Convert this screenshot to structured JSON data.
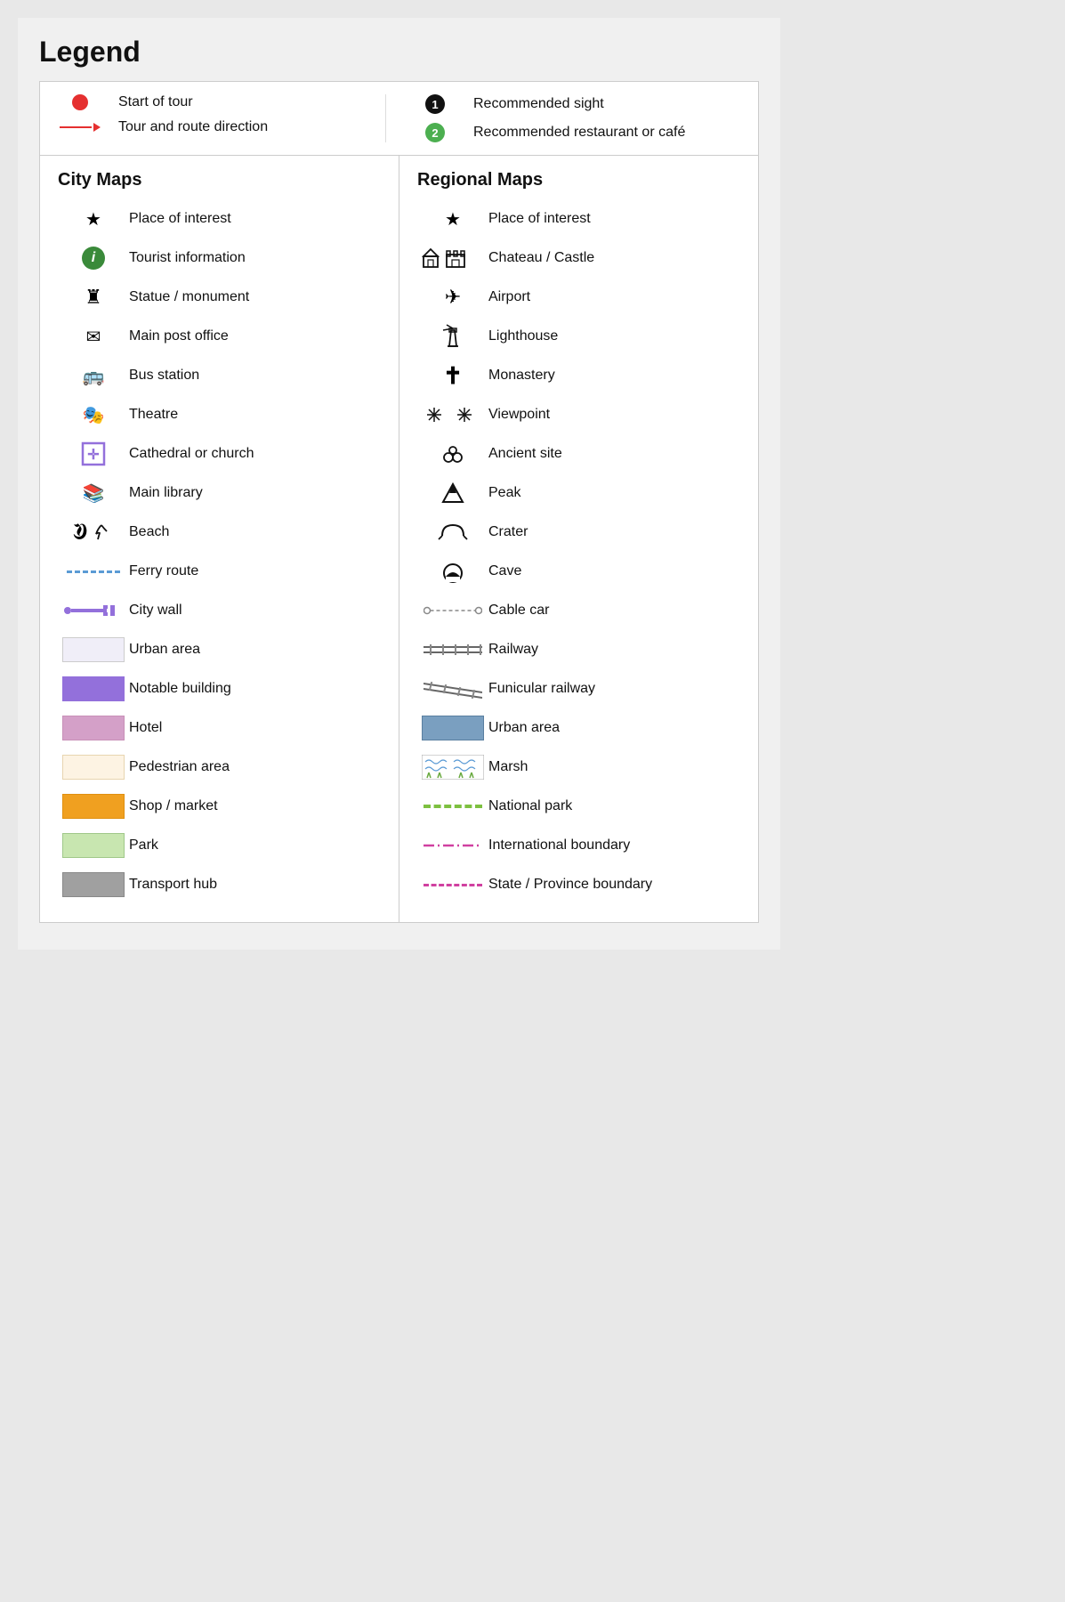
{
  "title": "Legend",
  "header": {
    "left_items": [
      {
        "id": "start-of-tour",
        "label": "Start of tour",
        "icon": "red-dot"
      },
      {
        "id": "tour-route",
        "label": "Tour and route direction",
        "icon": "red-arrow"
      }
    ],
    "right_items": [
      {
        "id": "recommended-sight",
        "label": "Recommended sight",
        "icon": "black-1"
      },
      {
        "id": "recommended-restaurant",
        "label": "Recommended restaurant or café",
        "icon": "green-2"
      }
    ]
  },
  "city_maps": {
    "heading": "City Maps",
    "items": [
      {
        "id": "place-of-interest",
        "label": "Place of interest",
        "icon": "star"
      },
      {
        "id": "tourist-information",
        "label": "Tourist information",
        "icon": "green-i"
      },
      {
        "id": "statue-monument",
        "label": "Statue / monument",
        "icon": "statue"
      },
      {
        "id": "main-post-office",
        "label": "Main post office",
        "icon": "envelope"
      },
      {
        "id": "bus-station",
        "label": "Bus station",
        "icon": "bus"
      },
      {
        "id": "theatre",
        "label": "Theatre",
        "icon": "theatre"
      },
      {
        "id": "cathedral-church",
        "label": "Cathedral or church",
        "icon": "church"
      },
      {
        "id": "main-library",
        "label": "Main library",
        "icon": "library"
      },
      {
        "id": "beach",
        "label": "Beach",
        "icon": "beach"
      },
      {
        "id": "ferry-route",
        "label": "Ferry route",
        "icon": "ferry"
      },
      {
        "id": "city-wall",
        "label": "City wall",
        "icon": "citywall"
      },
      {
        "id": "urban-area",
        "label": "Urban area",
        "icon": "swatch-white"
      },
      {
        "id": "notable-building",
        "label": "Notable building",
        "icon": "swatch-purple"
      },
      {
        "id": "hotel",
        "label": "Hotel",
        "icon": "swatch-pink"
      },
      {
        "id": "pedestrian-area",
        "label": "Pedestrian area",
        "icon": "swatch-cream"
      },
      {
        "id": "shop-market",
        "label": "Shop / market",
        "icon": "swatch-orange"
      },
      {
        "id": "park",
        "label": "Park",
        "icon": "swatch-green"
      },
      {
        "id": "transport-hub",
        "label": "Transport hub",
        "icon": "swatch-gray"
      }
    ]
  },
  "regional_maps": {
    "heading": "Regional Maps",
    "items": [
      {
        "id": "regional-place-of-interest",
        "label": "Place of interest",
        "icon": "star"
      },
      {
        "id": "chateau-castle",
        "label": "Chateau / Castle",
        "icon": "chateau"
      },
      {
        "id": "airport",
        "label": "Airport",
        "icon": "airport"
      },
      {
        "id": "lighthouse",
        "label": "Lighthouse",
        "icon": "lighthouse"
      },
      {
        "id": "monastery",
        "label": "Monastery",
        "icon": "monastery"
      },
      {
        "id": "viewpoint",
        "label": "Viewpoint",
        "icon": "viewpoint"
      },
      {
        "id": "ancient-site",
        "label": "Ancient site",
        "icon": "ancient"
      },
      {
        "id": "peak",
        "label": "Peak",
        "icon": "peak"
      },
      {
        "id": "crater",
        "label": "Crater",
        "icon": "crater"
      },
      {
        "id": "cave",
        "label": "Cave",
        "icon": "cave"
      },
      {
        "id": "cable-car",
        "label": "Cable car",
        "icon": "cablecar"
      },
      {
        "id": "railway",
        "label": "Railway",
        "icon": "railway"
      },
      {
        "id": "funicular-railway",
        "label": "Funicular railway",
        "icon": "funicular"
      },
      {
        "id": "regional-urban-area",
        "label": "Urban area",
        "icon": "swatch-blue"
      },
      {
        "id": "marsh",
        "label": "Marsh",
        "icon": "swatch-marsh"
      },
      {
        "id": "national-park",
        "label": "National park",
        "icon": "natpark"
      },
      {
        "id": "international-boundary",
        "label": "International boundary",
        "icon": "intl-boundary"
      },
      {
        "id": "state-boundary",
        "label": "State / Province boundary",
        "icon": "state-boundary"
      }
    ]
  }
}
